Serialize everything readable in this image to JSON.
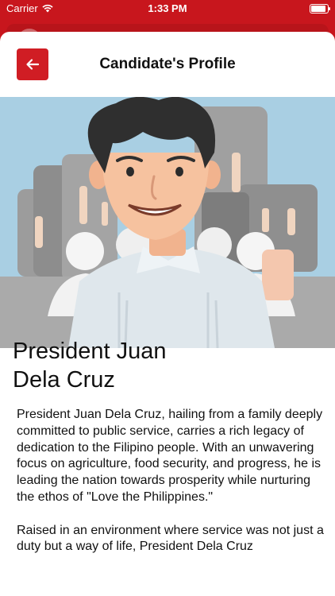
{
  "status_bar": {
    "carrier": "Carrier",
    "time": "1:33 PM",
    "icons": [
      "wifi-icon",
      "battery-icon"
    ],
    "battery_level": 1.0
  },
  "header": {
    "title": "Candidate's Profile",
    "back_icon": "arrow-left-icon"
  },
  "candidate": {
    "name_line1": "President Juan",
    "name_line2": "Dela Cruz",
    "bio_paragraphs": [
      "President Juan Dela Cruz, hailing from a family deeply committed to public service, carries a rich legacy of dedication to the Filipino people. With an unwavering focus on agriculture, food security, and progress, he is leading the nation towards prosperity while nurturing the ethos of \"Love the Philippines.\"",
      "Raised in an environment where service was not just a duty but a way of life, President Dela Cruz"
    ]
  },
  "colors": {
    "brand_red": "#c8161d",
    "button_red": "#d01d24",
    "sky": "#a9cfe3"
  }
}
